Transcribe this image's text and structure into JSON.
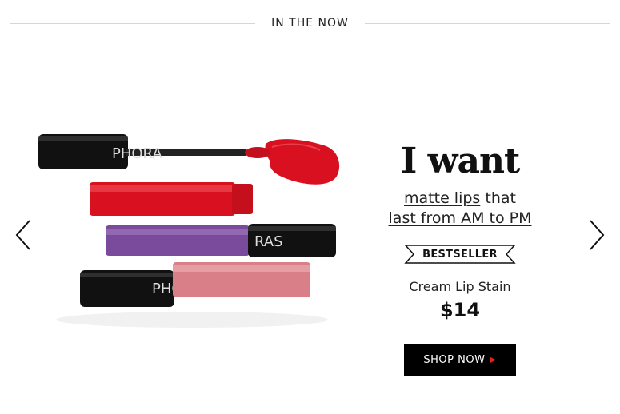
{
  "section": {
    "title": "IN THE NOW"
  },
  "promo": {
    "headline": "I want",
    "line1_underlined": "matte lips",
    "line1_rest": " that",
    "line2": "last from AM to PM",
    "badge": "BESTSELLER",
    "product_name": "Cream Lip Stain",
    "price": "$14",
    "cta_label": "SHOP NOW"
  },
  "product_image": {
    "brand_text": "PHORA"
  },
  "icons": {
    "prev": "chevron-left-icon",
    "next": "chevron-right-icon",
    "cta": "caret-right-icon"
  },
  "colors": {
    "button_bg": "#000000",
    "caret": "#e2231a",
    "lip_red": "#d8101f",
    "lip_purple": "#7a4a9c",
    "lip_pink": "#d97f88"
  }
}
